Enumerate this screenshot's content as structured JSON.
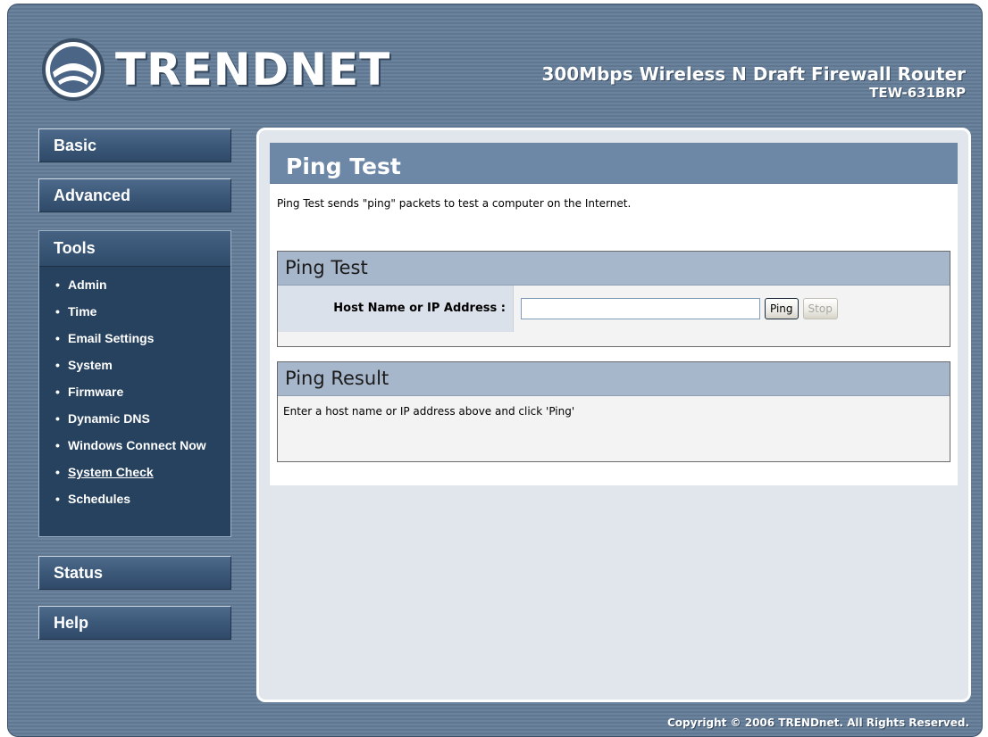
{
  "header": {
    "brand": "TRENDNET",
    "product_title": "300Mbps Wireless N Draft Firewall Router",
    "product_model": "TEW-631BRP"
  },
  "sidebar": {
    "basic": "Basic",
    "advanced": "Advanced",
    "tools": {
      "label": "Tools",
      "items": [
        {
          "label": "Admin"
        },
        {
          "label": "Time"
        },
        {
          "label": "Email Settings"
        },
        {
          "label": "System"
        },
        {
          "label": "Firmware"
        },
        {
          "label": "Dynamic DNS"
        },
        {
          "label": "Windows Connect Now"
        },
        {
          "label": "System Check",
          "current": true
        },
        {
          "label": "Schedules"
        }
      ]
    },
    "status": "Status",
    "help": "Help",
    "bullet": "•"
  },
  "main": {
    "title": "Ping Test",
    "intro": "Ping Test sends \"ping\" packets to test a computer on the Internet.",
    "ping_section": {
      "title": "Ping Test",
      "host_label": "Host Name or IP Address :",
      "host_value": "",
      "ping_button": "Ping",
      "stop_button": "Stop"
    },
    "result_section": {
      "title": "Ping Result",
      "message": "Enter a host name or IP address above and click 'Ping'"
    }
  },
  "footer": {
    "copyright": "Copyright © 2006 TRENDnet. All Rights Reserved."
  },
  "colors": {
    "frame_bg": "#6b839d",
    "title_bar": "#6d87a7",
    "section_head": "#a7b7cb",
    "nav_panel": "#27425f"
  },
  "icons": {
    "logo": "trendnet-logo-icon"
  }
}
